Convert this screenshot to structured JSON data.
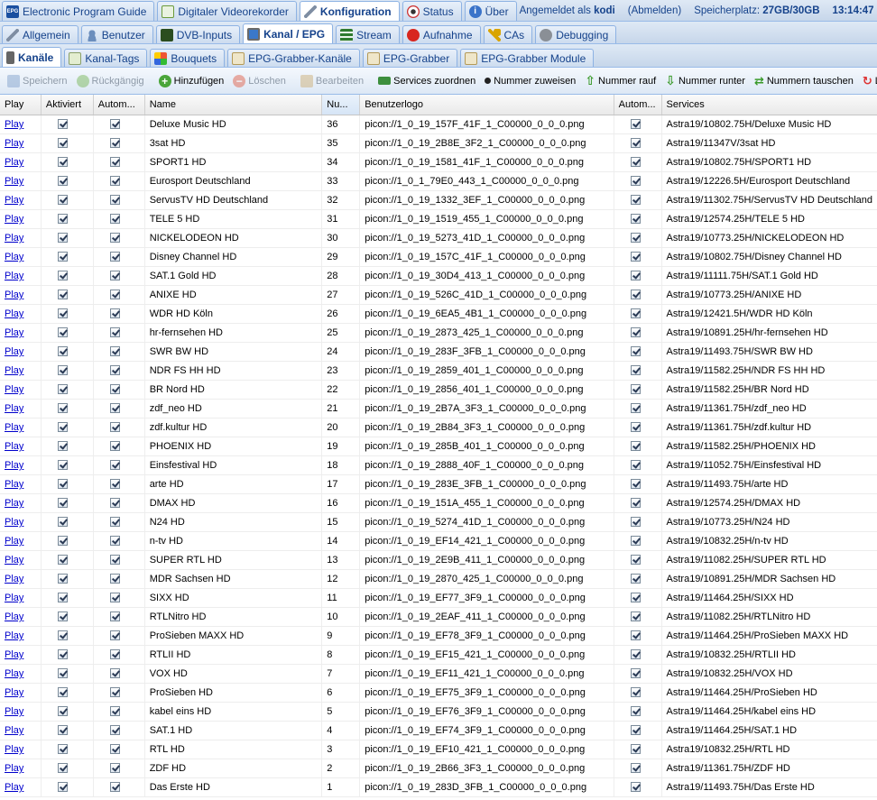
{
  "top_tabs": [
    {
      "label": "Electronic Program Guide",
      "icon": "epg-icon"
    },
    {
      "label": "Digitaler Videorekorder",
      "icon": "download-icon"
    },
    {
      "label": "Konfiguration",
      "icon": "wrench-icon",
      "active": true
    },
    {
      "label": "Status",
      "icon": "eye-icon"
    },
    {
      "label": "Über",
      "icon": "info-icon"
    }
  ],
  "status": {
    "logged_in_prefix": "Angemeldet als",
    "user": "kodi",
    "logout": "(Abmelden)",
    "storage_label": "Speicherplatz:",
    "storage_value": "27GB/30GB",
    "time": "13:14:47"
  },
  "config_tabs": [
    {
      "label": "Allgemein",
      "icon": "wrench-icon"
    },
    {
      "label": "Benutzer",
      "icon": "user-icon"
    },
    {
      "label": "DVB-Inputs",
      "icon": "dvb-icon"
    },
    {
      "label": "Kanal / EPG",
      "icon": "tv-icon",
      "active": true
    },
    {
      "label": "Stream",
      "icon": "stream-icon"
    },
    {
      "label": "Aufnahme",
      "icon": "rec-icon"
    },
    {
      "label": "CAs",
      "icon": "key-icon"
    },
    {
      "label": "Debugging",
      "icon": "bug-icon"
    }
  ],
  "channel_tabs": [
    {
      "label": "Kanäle",
      "icon": "phone-icon",
      "active": true
    },
    {
      "label": "Kanal-Tags",
      "icon": "tag-icon"
    },
    {
      "label": "Bouquets",
      "icon": "bouquet-icon"
    },
    {
      "label": "EPG-Grabber-Kanäle",
      "icon": "grabber-icon"
    },
    {
      "label": "EPG-Grabber",
      "icon": "grabber-icon"
    },
    {
      "label": "EPG-Grabber Module",
      "icon": "grabber-icon"
    }
  ],
  "toolbar": {
    "save": "Speichern",
    "undo": "Rückgängig",
    "add": "Hinzufügen",
    "delete": "Löschen",
    "edit": "Bearbeiten",
    "map_services": "Services zuordnen",
    "assign_number": "Nummer zuweisen",
    "number_up": "Nummer rauf",
    "number_down": "Nummer runter",
    "swap_numbers": "Nummern tauschen",
    "more": "Lo"
  },
  "columns": [
    "Play",
    "Aktiviert",
    "Autom...",
    "Name",
    "Nu...",
    "Benutzerlogo",
    "Autom...",
    "Services"
  ],
  "play_label": "Play",
  "channels": [
    {
      "name": "Deluxe Music HD",
      "number": "36",
      "logo": "picon://1_0_19_157F_41F_1_C00000_0_0_0.png",
      "service": "Astra19/10802.75H/Deluxe Music HD"
    },
    {
      "name": "3sat HD",
      "number": "35",
      "logo": "picon://1_0_19_2B8E_3F2_1_C00000_0_0_0.png",
      "service": "Astra19/11347V/3sat HD"
    },
    {
      "name": "SPORT1 HD",
      "number": "34",
      "logo": "picon://1_0_19_1581_41F_1_C00000_0_0_0.png",
      "service": "Astra19/10802.75H/SPORT1 HD"
    },
    {
      "name": "Eurosport Deutschland",
      "number": "33",
      "logo": "picon://1_0_1_79E0_443_1_C00000_0_0_0.png",
      "service": "Astra19/12226.5H/Eurosport Deutschland"
    },
    {
      "name": "ServusTV HD Deutschland",
      "number": "32",
      "logo": "picon://1_0_19_1332_3EF_1_C00000_0_0_0.png",
      "service": "Astra19/11302.75H/ServusTV HD Deutschland"
    },
    {
      "name": "TELE 5 HD",
      "number": "31",
      "logo": "picon://1_0_19_1519_455_1_C00000_0_0_0.png",
      "service": "Astra19/12574.25H/TELE 5 HD"
    },
    {
      "name": "NICKELODEON HD",
      "number": "30",
      "logo": "picon://1_0_19_5273_41D_1_C00000_0_0_0.png",
      "service": "Astra19/10773.25H/NICKELODEON HD"
    },
    {
      "name": "Disney Channel HD",
      "number": "29",
      "logo": "picon://1_0_19_157C_41F_1_C00000_0_0_0.png",
      "service": "Astra19/10802.75H/Disney Channel HD"
    },
    {
      "name": "SAT.1 Gold HD",
      "number": "28",
      "logo": "picon://1_0_19_30D4_413_1_C00000_0_0_0.png",
      "service": "Astra19/11111.75H/SAT.1 Gold HD"
    },
    {
      "name": "ANIXE HD",
      "number": "27",
      "logo": "picon://1_0_19_526C_41D_1_C00000_0_0_0.png",
      "service": "Astra19/10773.25H/ANIXE HD"
    },
    {
      "name": "WDR HD Köln",
      "number": "26",
      "logo": "picon://1_0_19_6EA5_4B1_1_C00000_0_0_0.png",
      "service": "Astra19/12421.5H/WDR HD Köln"
    },
    {
      "name": "hr-fernsehen HD",
      "number": "25",
      "logo": "picon://1_0_19_2873_425_1_C00000_0_0_0.png",
      "service": "Astra19/10891.25H/hr-fernsehen HD"
    },
    {
      "name": "SWR BW HD",
      "number": "24",
      "logo": "picon://1_0_19_283F_3FB_1_C00000_0_0_0.png",
      "service": "Astra19/11493.75H/SWR BW HD"
    },
    {
      "name": "NDR FS HH HD",
      "number": "23",
      "logo": "picon://1_0_19_2859_401_1_C00000_0_0_0.png",
      "service": "Astra19/11582.25H/NDR FS HH HD"
    },
    {
      "name": "BR Nord HD",
      "number": "22",
      "logo": "picon://1_0_19_2856_401_1_C00000_0_0_0.png",
      "service": "Astra19/11582.25H/BR Nord HD"
    },
    {
      "name": "zdf_neo HD",
      "number": "21",
      "logo": "picon://1_0_19_2B7A_3F3_1_C00000_0_0_0.png",
      "service": "Astra19/11361.75H/zdf_neo HD"
    },
    {
      "name": "zdf.kultur HD",
      "number": "20",
      "logo": "picon://1_0_19_2B84_3F3_1_C00000_0_0_0.png",
      "service": "Astra19/11361.75H/zdf.kultur HD"
    },
    {
      "name": "PHOENIX HD",
      "number": "19",
      "logo": "picon://1_0_19_285B_401_1_C00000_0_0_0.png",
      "service": "Astra19/11582.25H/PHOENIX HD"
    },
    {
      "name": "Einsfestival HD",
      "number": "18",
      "logo": "picon://1_0_19_2888_40F_1_C00000_0_0_0.png",
      "service": "Astra19/11052.75H/Einsfestival HD"
    },
    {
      "name": "arte HD",
      "number": "17",
      "logo": "picon://1_0_19_283E_3FB_1_C00000_0_0_0.png",
      "service": "Astra19/11493.75H/arte HD"
    },
    {
      "name": "DMAX HD",
      "number": "16",
      "logo": "picon://1_0_19_151A_455_1_C00000_0_0_0.png",
      "service": "Astra19/12574.25H/DMAX HD"
    },
    {
      "name": "N24 HD",
      "number": "15",
      "logo": "picon://1_0_19_5274_41D_1_C00000_0_0_0.png",
      "service": "Astra19/10773.25H/N24 HD"
    },
    {
      "name": "n-tv HD",
      "number": "14",
      "logo": "picon://1_0_19_EF14_421_1_C00000_0_0_0.png",
      "service": "Astra19/10832.25H/n-tv HD"
    },
    {
      "name": "SUPER RTL HD",
      "number": "13",
      "logo": "picon://1_0_19_2E9B_411_1_C00000_0_0_0.png",
      "service": "Astra19/11082.25H/SUPER RTL HD"
    },
    {
      "name": "MDR Sachsen HD",
      "number": "12",
      "logo": "picon://1_0_19_2870_425_1_C00000_0_0_0.png",
      "service": "Astra19/10891.25H/MDR Sachsen HD"
    },
    {
      "name": "SIXX HD",
      "number": "11",
      "logo": "picon://1_0_19_EF77_3F9_1_C00000_0_0_0.png",
      "service": "Astra19/11464.25H/SIXX HD"
    },
    {
      "name": "RTLNitro HD",
      "number": "10",
      "logo": "picon://1_0_19_2EAF_411_1_C00000_0_0_0.png",
      "service": "Astra19/11082.25H/RTLNitro HD"
    },
    {
      "name": "ProSieben MAXX HD",
      "number": "9",
      "logo": "picon://1_0_19_EF78_3F9_1_C00000_0_0_0.png",
      "service": "Astra19/11464.25H/ProSieben MAXX HD"
    },
    {
      "name": "RTLII HD",
      "number": "8",
      "logo": "picon://1_0_19_EF15_421_1_C00000_0_0_0.png",
      "service": "Astra19/10832.25H/RTLII HD"
    },
    {
      "name": "VOX HD",
      "number": "7",
      "logo": "picon://1_0_19_EF11_421_1_C00000_0_0_0.png",
      "service": "Astra19/10832.25H/VOX HD"
    },
    {
      "name": "ProSieben HD",
      "number": "6",
      "logo": "picon://1_0_19_EF75_3F9_1_C00000_0_0_0.png",
      "service": "Astra19/11464.25H/ProSieben HD"
    },
    {
      "name": "kabel eins HD",
      "number": "5",
      "logo": "picon://1_0_19_EF76_3F9_1_C00000_0_0_0.png",
      "service": "Astra19/11464.25H/kabel eins HD"
    },
    {
      "name": "SAT.1 HD",
      "number": "4",
      "logo": "picon://1_0_19_EF74_3F9_1_C00000_0_0_0.png",
      "service": "Astra19/11464.25H/SAT.1 HD"
    },
    {
      "name": "RTL HD",
      "number": "3",
      "logo": "picon://1_0_19_EF10_421_1_C00000_0_0_0.png",
      "service": "Astra19/10832.25H/RTL HD"
    },
    {
      "name": "ZDF HD",
      "number": "2",
      "logo": "picon://1_0_19_2B66_3F3_1_C00000_0_0_0.png",
      "service": "Astra19/11361.75H/ZDF HD"
    },
    {
      "name": "Das Erste HD",
      "number": "1",
      "logo": "picon://1_0_19_283D_3FB_1_C00000_0_0_0.png",
      "service": "Astra19/11493.75H/Das Erste HD"
    }
  ]
}
